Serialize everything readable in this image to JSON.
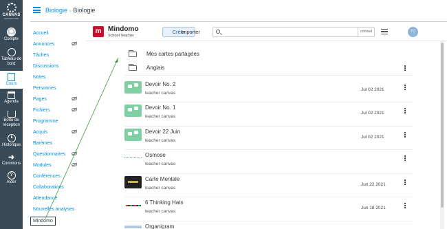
{
  "global_nav": {
    "logo_text": "CANVAS",
    "logo_sub": "INSTRUCTURE",
    "items": [
      {
        "label": "Compte",
        "icon": "account-avatar-icon"
      },
      {
        "label": "Tableau de bord",
        "icon": "dashboard-icon"
      },
      {
        "label": "Cours",
        "icon": "courses-book-icon"
      },
      {
        "label": "Agenda",
        "icon": "calendar-icon"
      },
      {
        "label": "Boîte de réception",
        "icon": "inbox-icon"
      },
      {
        "label": "Historique",
        "icon": "history-clock-icon"
      },
      {
        "label": "Commons",
        "icon": "commons-arrow-icon"
      },
      {
        "label": "Aider",
        "icon": "help-icon"
      }
    ]
  },
  "breadcrumb": {
    "course": "Biologie",
    "separator": "›",
    "current": "Biologie"
  },
  "course_nav": {
    "items": [
      {
        "label": "Accueil",
        "hidden": false
      },
      {
        "label": "Annonces",
        "hidden": true
      },
      {
        "label": "Tâches",
        "hidden": false
      },
      {
        "label": "Discussions",
        "hidden": false
      },
      {
        "label": "Notes",
        "hidden": false
      },
      {
        "label": "Personnes",
        "hidden": false
      },
      {
        "label": "Pages",
        "hidden": true
      },
      {
        "label": "Fichiers",
        "hidden": true
      },
      {
        "label": "Programme",
        "hidden": false
      },
      {
        "label": "Acquis",
        "hidden": true
      },
      {
        "label": "Barèmes",
        "hidden": false
      },
      {
        "label": "Questionnaires",
        "hidden": true
      },
      {
        "label": "Modules",
        "hidden": true
      },
      {
        "label": "Conférences",
        "hidden": false
      },
      {
        "label": "Collaborations",
        "hidden": false
      },
      {
        "label": "Attendance",
        "hidden": false
      },
      {
        "label": "Nouvelles analyses",
        "hidden": false
      }
    ],
    "active_item": "Mindomo"
  },
  "mindomo": {
    "logo_letter": "m",
    "brand": "Mindomo",
    "edition": "School Teacher",
    "create_label": "Créer",
    "import_label": "Importer",
    "search_placeholder": "",
    "search_tip": "conseil",
    "user_initials": "TC"
  },
  "folders": [
    {
      "title": "Mes cartes partagées",
      "has_menu": false
    },
    {
      "title": "Anglais",
      "has_menu": true
    }
  ],
  "maps": [
    {
      "title": "Devoir No. 2",
      "owner": "teacher canvas",
      "date": "Jul 02 2021",
      "thumb": "green"
    },
    {
      "title": "Devoir No. 1",
      "owner": "teacher canvas",
      "date": "Jul 02 2021",
      "thumb": "green"
    },
    {
      "title": "Devoir 22 Juin",
      "owner": "teacher canvas",
      "date": "Jul 02 2021",
      "thumb": "green"
    },
    {
      "title": "Osmose",
      "owner": "teacher canvas",
      "date": "",
      "thumb": "line"
    },
    {
      "title": "Carte Mentale",
      "owner": "teacher canvas",
      "date": "Jun 22 2021",
      "thumb": "dark"
    },
    {
      "title": "6 Thinking Hats",
      "owner": "teacher canvas",
      "date": "Jun 18 2021",
      "thumb": "hats"
    },
    {
      "title": "Organigram",
      "owner": "",
      "date": "",
      "thumb": "org"
    }
  ],
  "colors": {
    "link": "#008ee2",
    "rail": "#394b58",
    "annotation_arrow": "#3a9a3a"
  }
}
